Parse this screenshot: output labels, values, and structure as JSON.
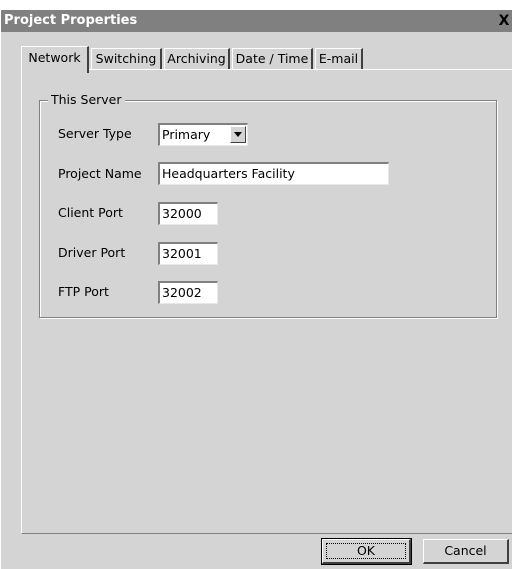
{
  "window": {
    "title": "Project Properties",
    "close_glyph": "X"
  },
  "tabs": [
    {
      "label": "Network",
      "active": true
    },
    {
      "label": "Switching",
      "active": false
    },
    {
      "label": "Archiving",
      "active": false
    },
    {
      "label": "Date / Time",
      "active": false
    },
    {
      "label": "E-mail",
      "active": false
    }
  ],
  "group": {
    "title": "This Server",
    "server_type": {
      "label": "Server Type",
      "value": "Primary"
    },
    "project_name": {
      "label": "Project Name",
      "value": "Headquarters Facility"
    },
    "client_port": {
      "label": "Client Port",
      "value": "32000"
    },
    "driver_port": {
      "label": "Driver Port",
      "value": "32001"
    },
    "ftp_port": {
      "label": "FTP Port",
      "value": "32002"
    }
  },
  "buttons": {
    "ok": "OK",
    "cancel": "Cancel"
  }
}
